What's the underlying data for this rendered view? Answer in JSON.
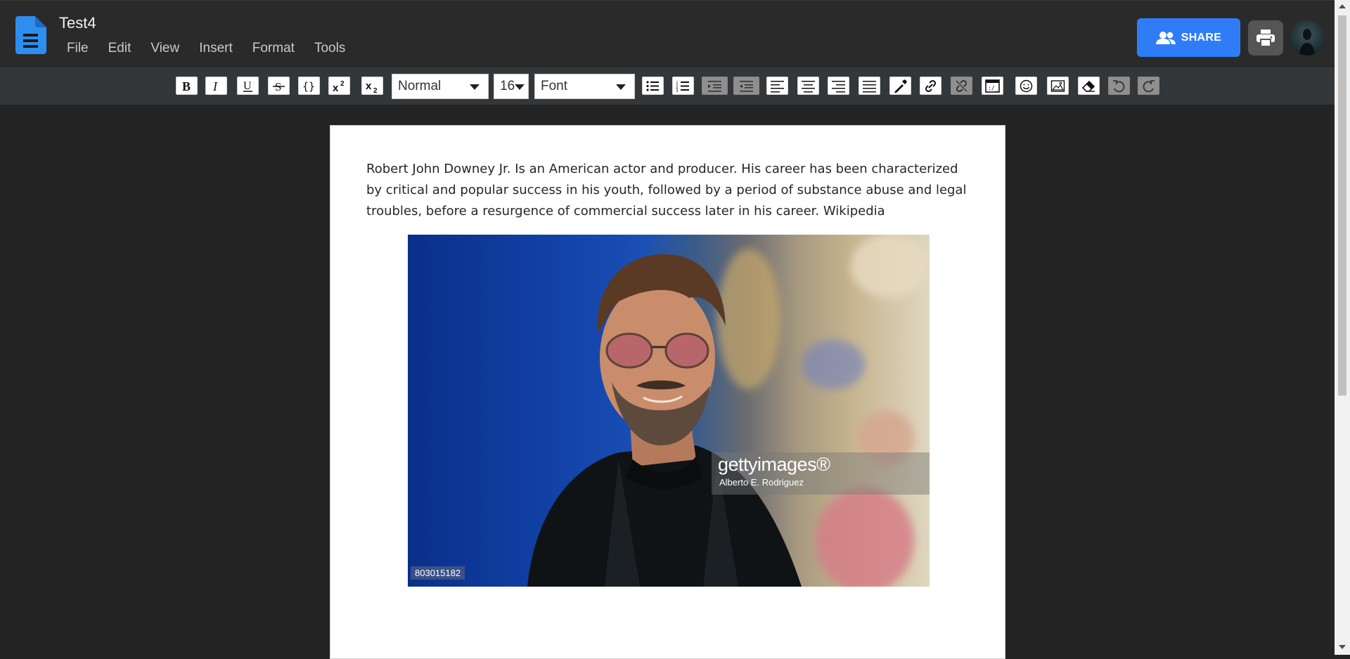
{
  "app": {
    "doc_title": "Test4",
    "menu": [
      "File",
      "Edit",
      "View",
      "Insert",
      "Format",
      "Tools"
    ],
    "share_label": "SHARE",
    "brand_color": "#2f7df6"
  },
  "toolbar": {
    "buttons": [
      {
        "name": "bold",
        "icon": "bold-icon"
      },
      {
        "name": "italic",
        "icon": "italic-icon"
      },
      {
        "name": "underline",
        "icon": "underline-icon"
      },
      {
        "name": "strikethrough",
        "icon": "strikethrough-icon"
      },
      {
        "name": "code",
        "icon": "code-braces-icon"
      },
      {
        "name": "superscript",
        "icon": "superscript-icon"
      },
      {
        "name": "subscript",
        "icon": "subscript-icon"
      }
    ],
    "paragraph_style": "Normal",
    "font_size": "16",
    "font_family": "Font",
    "buttons2": [
      "bulleted-list-icon",
      "numbered-list-icon",
      "indent-icon",
      "outdent-icon",
      "align-left-icon",
      "align-center-icon",
      "align-right-icon",
      "align-justify-icon",
      "color-picker-icon",
      "link-icon",
      "unlink-icon",
      "embed-icon",
      "emoji-icon",
      "image-icon",
      "eraser-icon",
      "undo-icon",
      "redo-icon"
    ]
  },
  "document": {
    "paragraph": "Robert John Downey Jr. Is an American actor and producer. His career has been characterized by critical and popular success in his youth, followed by a period of substance abuse and legal troubles, before a resurgence of commercial success later in his career. Wikipedia",
    "image": {
      "watermark_logo": "gettyimages®",
      "credit": "Alberto E. Rodriguez",
      "image_id": "803015182"
    }
  }
}
